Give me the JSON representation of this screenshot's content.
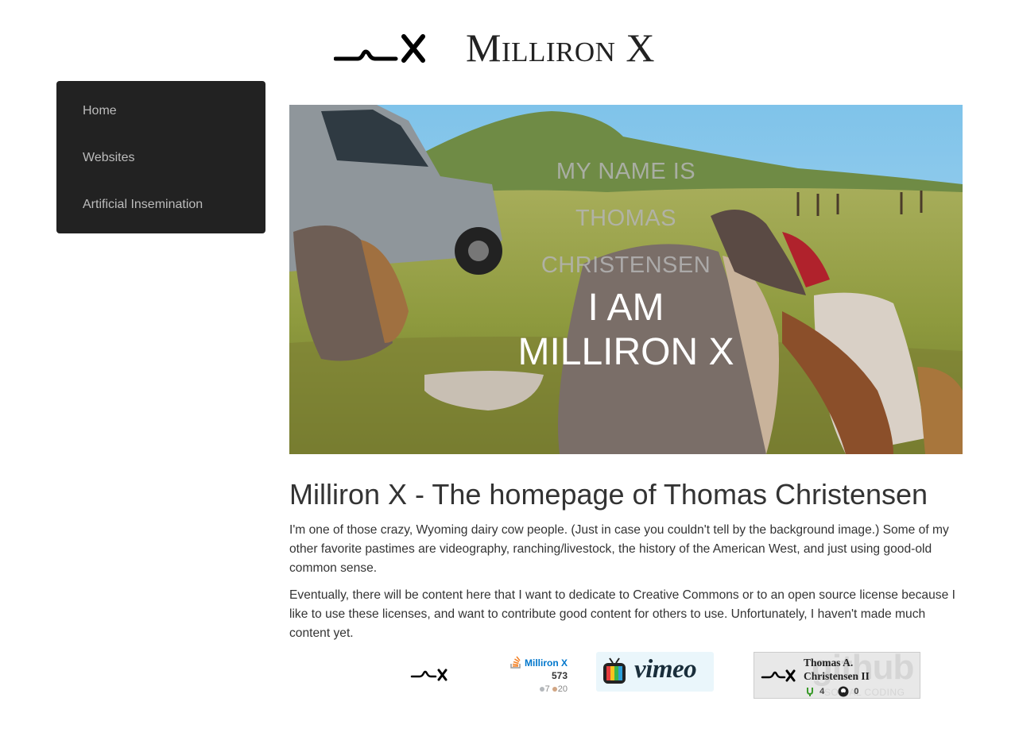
{
  "header": {
    "title": "Milliron X",
    "logo_icon": "milliron-x-logo-icon"
  },
  "sidebar": {
    "items": [
      {
        "label": "Home"
      },
      {
        "label": "Websites"
      },
      {
        "label": "Artificial Insemination"
      }
    ]
  },
  "hero": {
    "image": "ranch-saddles-truck-photo",
    "line1": "My name is",
    "line2": "Thomas",
    "line3": "Christensen",
    "big1": "I am",
    "big2": "Milliron X"
  },
  "main": {
    "heading": "Milliron X - The homepage of Thomas Christensen",
    "paragraphs": [
      "I'm one of those crazy, Wyoming dairy cow people. (Just in case you couldn't tell by the background image.) Some of my other favorite pastimes are videography, ranching/livestock, the history of the American West, and just using good-old common sense.",
      "Eventually, there will be content here that I want to dedicate to Creative Commons or to an open source license because I like to use these licenses, and want to contribute good content for others to use. Unfortunately, I haven't made much content yet."
    ]
  },
  "badges": {
    "stackoverflow": {
      "name": "Milliron X",
      "reputation": "573",
      "silver": "7",
      "bronze": "20",
      "silver_color": "#b4b8bc",
      "bronze_color": "#d1a684"
    },
    "vimeo": {
      "label": "vimeo"
    },
    "github": {
      "name_line1": "Thomas A.",
      "name_line2": "Christensen II",
      "watermark": "github",
      "watermark_sub": "SOCIAL CODING",
      "repos": "4",
      "followers": "0"
    }
  }
}
